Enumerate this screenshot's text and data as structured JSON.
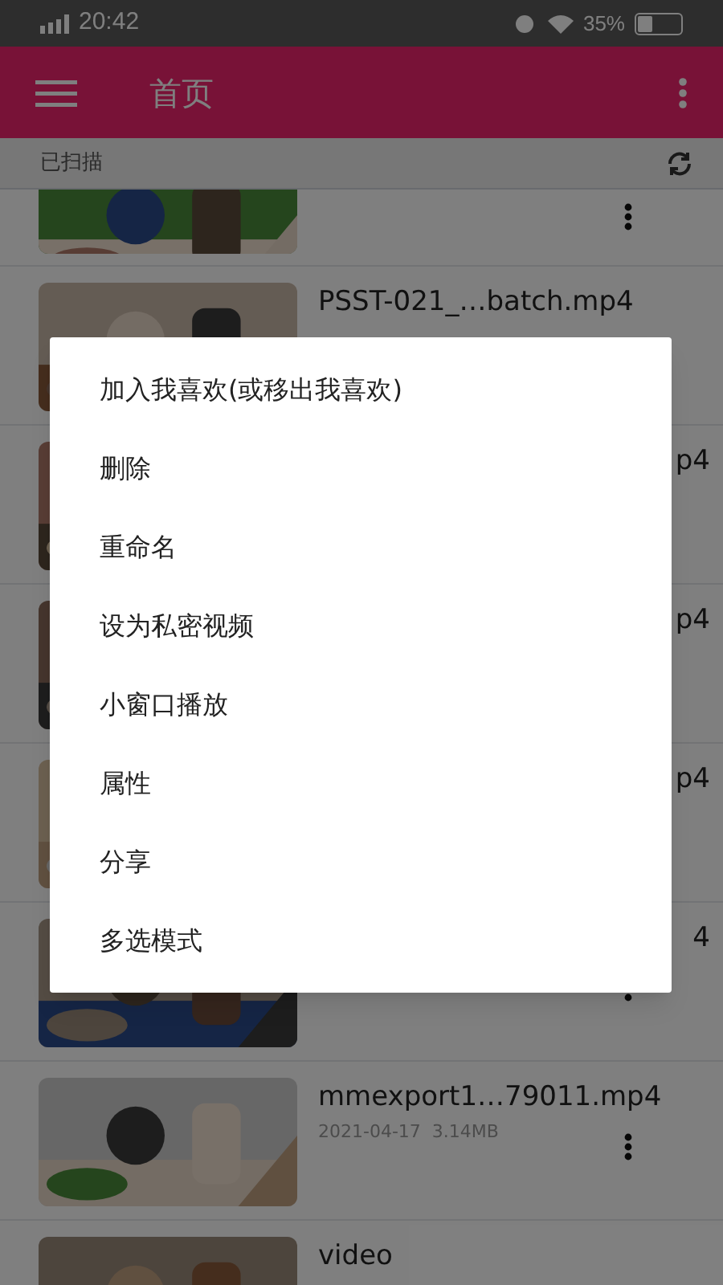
{
  "status_bar": {
    "time": "20:42",
    "battery": "35%"
  },
  "app_bar": {
    "title": "首页"
  },
  "subheader": {
    "label": "已扫描"
  },
  "videos": [
    {
      "kind": "cut_top",
      "more": true
    },
    {
      "kind": "full",
      "title": "PSST-021_…batch.mp4"
    },
    {
      "kind": "covered",
      "title": "p4"
    },
    {
      "kind": "covered",
      "title": "p4"
    },
    {
      "kind": "covered",
      "title": "p4"
    },
    {
      "kind": "covered",
      "title": "4",
      "more": true
    },
    {
      "kind": "full",
      "title": "mmexport1…79011.mp4",
      "meta": "2021-04-17  3.14MB",
      "more": true
    },
    {
      "kind": "cut_bottom",
      "title": "video"
    }
  ],
  "dialog": {
    "items": [
      "加入我喜欢(或移出我喜欢)",
      "删除",
      "重命名",
      "设为私密视频",
      "小窗口播放",
      "属性",
      "分享",
      "多选模式"
    ]
  }
}
